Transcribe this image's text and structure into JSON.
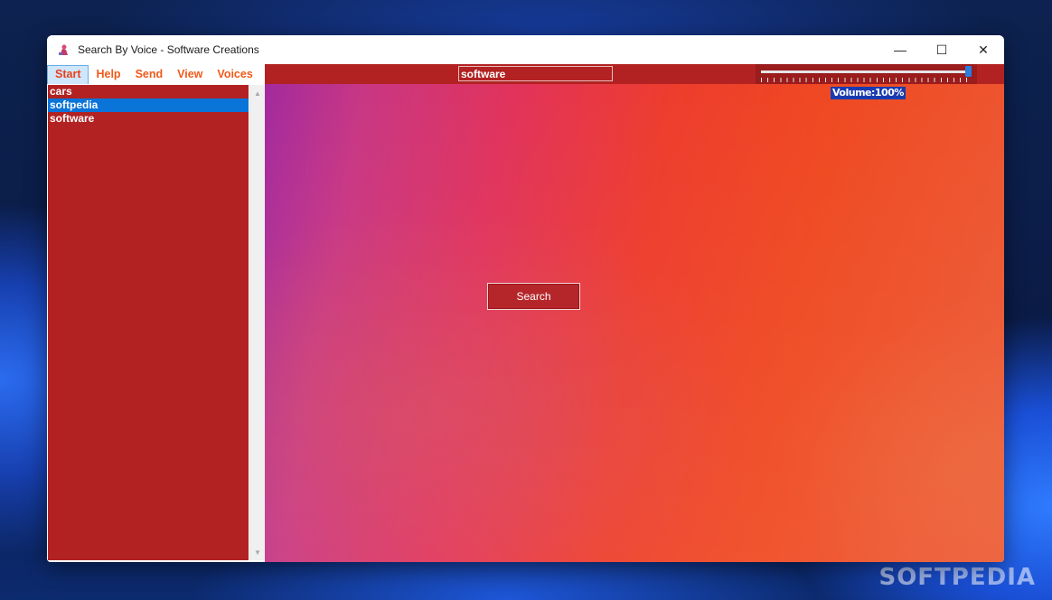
{
  "window": {
    "title": "Search By Voice - Software Creations",
    "controls": {
      "minimize": "—",
      "maximize": "☐",
      "close": "✕"
    }
  },
  "menu": {
    "items": [
      {
        "label": "Start",
        "active": true
      },
      {
        "label": "Help"
      },
      {
        "label": "Send"
      },
      {
        "label": "View"
      },
      {
        "label": "Voices"
      }
    ]
  },
  "history": {
    "items": [
      {
        "label": "cars"
      },
      {
        "label": "softpedia",
        "selected": true
      },
      {
        "label": "software"
      }
    ]
  },
  "search": {
    "value": "software",
    "button_label": "Search"
  },
  "volume": {
    "label": "Volume:100%",
    "level": 1.0
  },
  "colors": {
    "panel_red": "#b22222",
    "selection_blue": "#0a74d9",
    "menu_orange": "#f05a1a",
    "slider_thumb": "#2a7de1"
  },
  "watermark": "SOFTPEDIA"
}
